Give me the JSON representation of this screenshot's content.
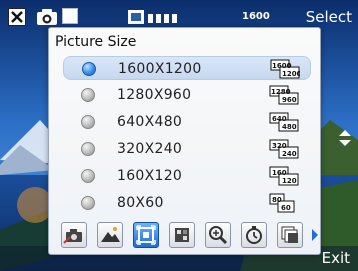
{
  "topbar": {
    "select_label": "Select",
    "exit_label": "Exit",
    "icons": [
      "close-icon",
      "camera-icon",
      "white-square-icon",
      "resolution-icon"
    ],
    "top_res_text": "1600"
  },
  "panel": {
    "title": "Picture Size",
    "options": [
      {
        "label": "1600X1200",
        "icon_text_top": "1600",
        "icon_text_bottom": "1200",
        "selected": true
      },
      {
        "label": "1280X960",
        "icon_text_top": "1280",
        "icon_text_bottom": "960",
        "selected": false
      },
      {
        "label": "640X480",
        "icon_text_top": "640",
        "icon_text_bottom": "480",
        "selected": false
      },
      {
        "label": "320X240",
        "icon_text_top": "320",
        "icon_text_bottom": "240",
        "selected": false
      },
      {
        "label": "160X120",
        "icon_text_top": "160",
        "icon_text_bottom": "120",
        "selected": false
      },
      {
        "label": "80X60",
        "icon_text_top": "80",
        "icon_text_bottom": "60",
        "selected": false
      }
    ]
  },
  "icon_strip": {
    "icons": [
      "camera-settings-icon",
      "scene-mountain-icon",
      "picture-size-icon",
      "quality-icon",
      "zoom-icon",
      "timer-icon",
      "multishot-icon"
    ],
    "active_index": 2
  },
  "colors": {
    "accent": "#1e6fd8",
    "panel_bg": "#f4f6f9",
    "select_text": "#ffffff"
  }
}
